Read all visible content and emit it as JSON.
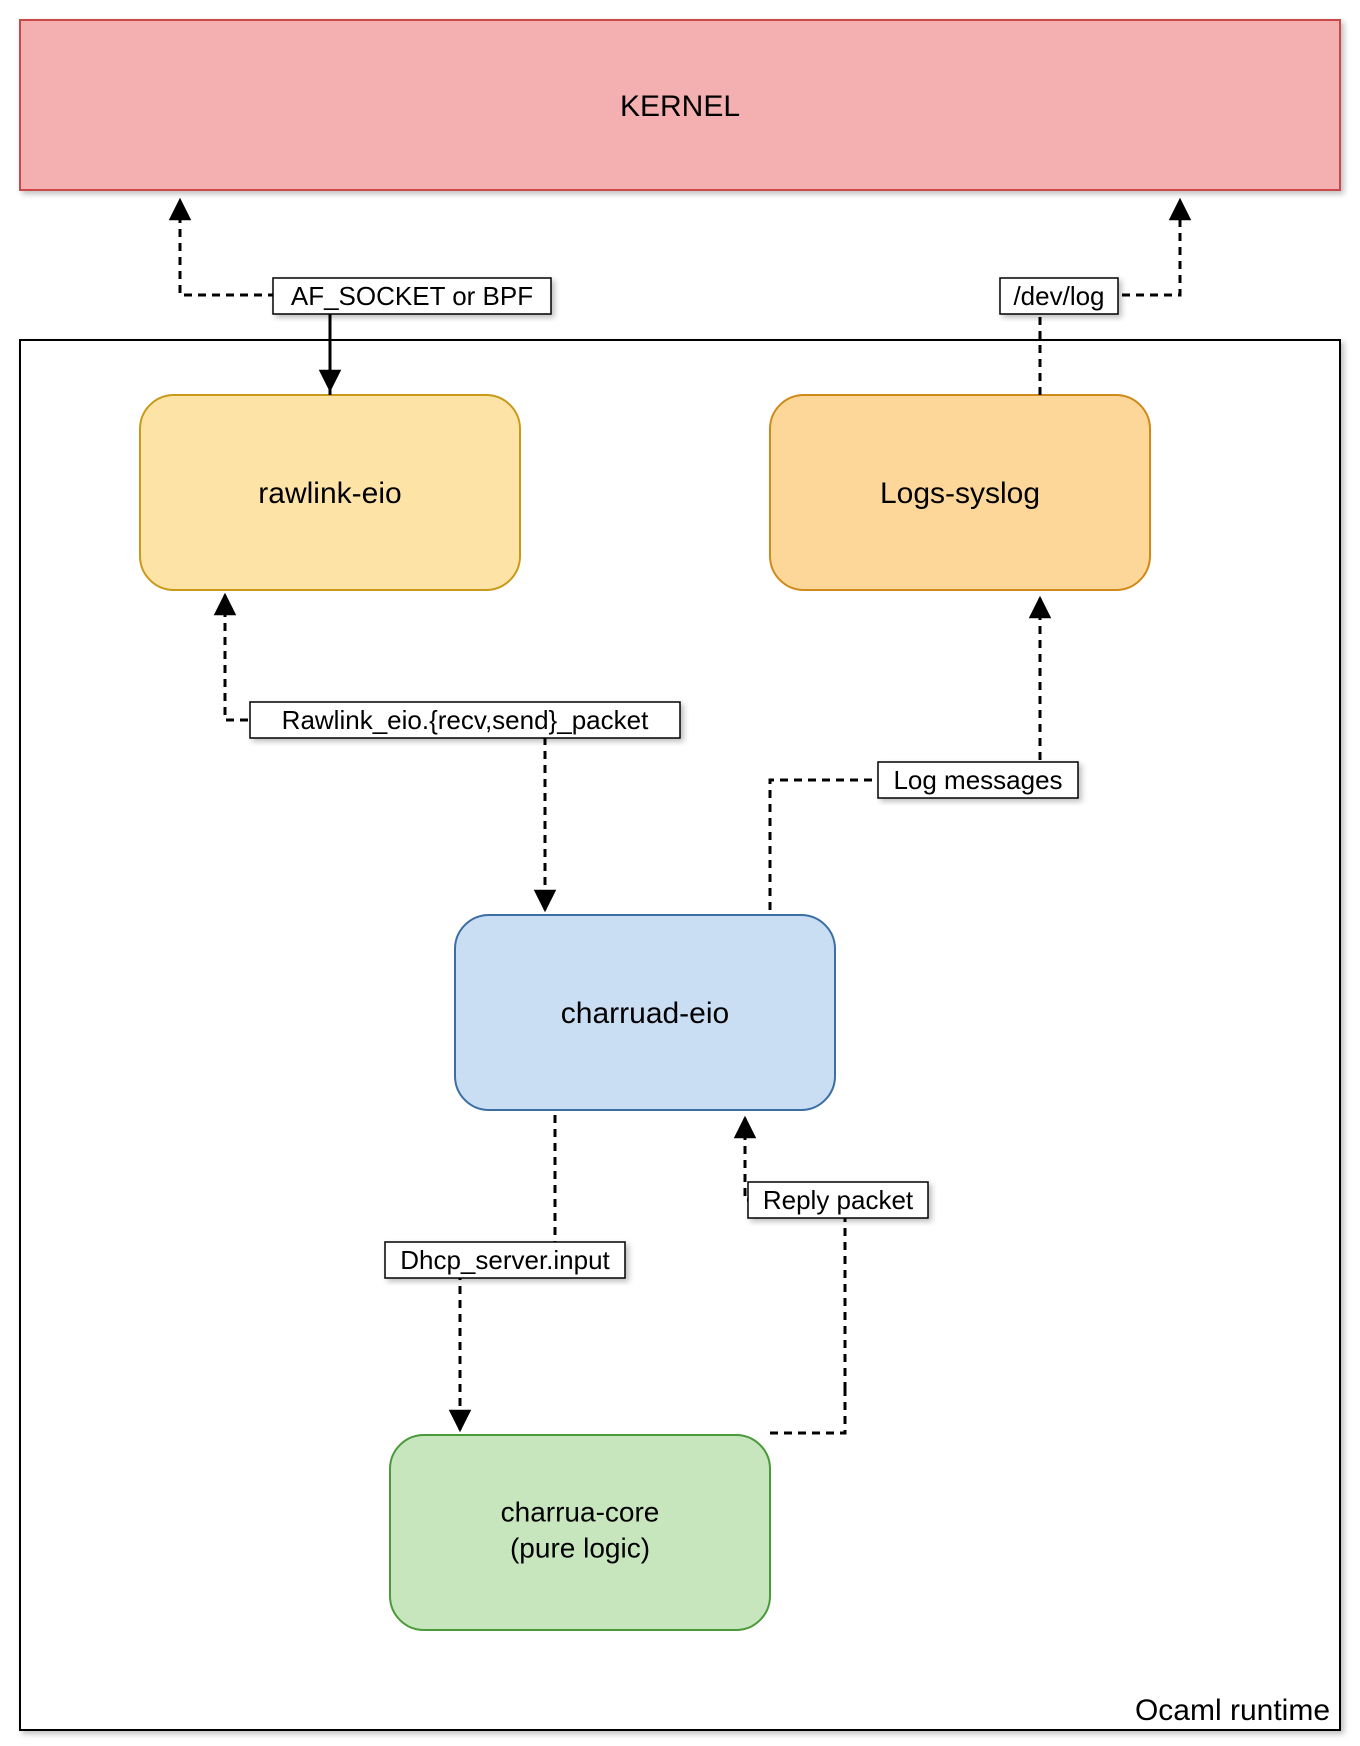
{
  "kernel": {
    "label": "KERNEL"
  },
  "runtime": {
    "label": "Ocaml runtime"
  },
  "nodes": {
    "rawlink": {
      "label": "rawlink-eio"
    },
    "logs": {
      "label": "Logs-syslog"
    },
    "charruad": {
      "label": "charruad-eio"
    },
    "core": {
      "label1": "charrua-core",
      "label2": "(pure logic)"
    }
  },
  "edges": {
    "afsocket": {
      "label": "AF_SOCKET or BPF"
    },
    "devlog": {
      "label": "/dev/log"
    },
    "rawlinkapi": {
      "label": "Rawlink_eio.{recv,send}_packet"
    },
    "logmsgs": {
      "label": "Log messages"
    },
    "dhcpinput": {
      "label": "Dhcp_server.input"
    },
    "replypkt": {
      "label": "Reply packet"
    }
  }
}
